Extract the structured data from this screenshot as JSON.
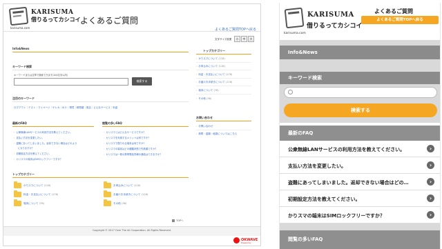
{
  "brand": {
    "name_en": "KARISUMA",
    "name_jp": "借りるってカシコイ",
    "domain": "karisuma.com"
  },
  "desktop": {
    "page_title": "よくあるご質問",
    "top_link": "よくあるご質問TOPへ戻る",
    "font_size_label": "文字サイズ変更",
    "font_sizes": [
      "小",
      "中",
      "大"
    ],
    "info_heading": "Info&News",
    "keyword_heading": "キーワード検索",
    "keyword_hint": "キーワードまたは文章で検索できます(200文字以内)",
    "search_button": "検索する",
    "popular_keywords_heading": "注目のキーワード",
    "popular_keywords": "ログアウト｜テスト｜マイページ｜ゲレカ｜ゆう｜環境｜精算額｜風呂｜どんなサービス｜料金",
    "latest_faq_heading": "最新のFAQ",
    "latest_faq": [
      "公衆無線LANサービスの利用方法を教えてください。",
      "支払い方法を変更したい。",
      "盗難にあってしまいました。返却できない場合はどのよう",
      "になりますか？",
      "初期設定方法を教えてください。",
      "カリスマの端末はSIMロックフリーですか？"
    ],
    "popular_faq_heading": "閲覧の多いFAQ",
    "popular_faq": [
      "カリスマとはどんなサービスですか？",
      "カリスマを利用するメリットは何ですか？",
      "カリスマで借りれる端末は何ですか？",
      "カリスマの端末はどの種類状態で先着順ですか？",
      "カリスマは一般の携帯電話同様の通信はできますか？"
    ],
    "top_category_heading": "トップカテゴリー",
    "categories": [
      {
        "label": "かりスマについて",
        "count": "(118)"
      },
      {
        "label": "お申込みについて",
        "count": "(118)"
      },
      {
        "label": "料金・お支払いについて",
        "count": "(176)"
      },
      {
        "label": "お届けお手続きについて",
        "count": "(118)"
      },
      {
        "label": "端末について",
        "count": "(78)"
      },
      {
        "label": "その他",
        "count": "(36)"
      }
    ],
    "sidebar_heading": "トップカテゴリー",
    "sidebar_items": [
      {
        "label": "かりスマについて",
        "count": "(118)"
      },
      {
        "label": "お申込みについて",
        "count": "(118)"
      },
      {
        "label": "料金・お支払いについて",
        "count": "(176)"
      },
      {
        "label": "お届けお手続きについて",
        "count": "(118)"
      },
      {
        "label": "端末について",
        "count": "(78)"
      },
      {
        "label": "その他",
        "count": "(36)"
      }
    ],
    "contact_heading": "お問い合わせ",
    "contact_items": [
      "お問い合わせ",
      "故障・盗難・破損についてはこちら"
    ],
    "top_anchor": "TOPへ",
    "copyright": "Copyright © 2017 Over The Air Corporation. All Rights Reserved.",
    "okwave": "OKWAVE",
    "okwave_sub": "Powered by"
  },
  "mobile": {
    "page_title": "よくあるご質問",
    "top_button": "よくあるご質問TOPへ戻る",
    "info_heading": "Info&News",
    "keyword_heading": "キーワード検索",
    "search_button": "検索する",
    "latest_faq_heading": "最新のFAQ",
    "latest_faq": [
      "公衆無線LANサービスの利用方法を教えてください。",
      "支払い方法を変更したい。",
      "盗難にあってしまいました。返却できない場合はどの…",
      "初期設定方法を教えてください。",
      "かりスマの端末はSIMロックフリーですか？"
    ],
    "popular_faq_heading": "閲覧の多いFAQ"
  }
}
